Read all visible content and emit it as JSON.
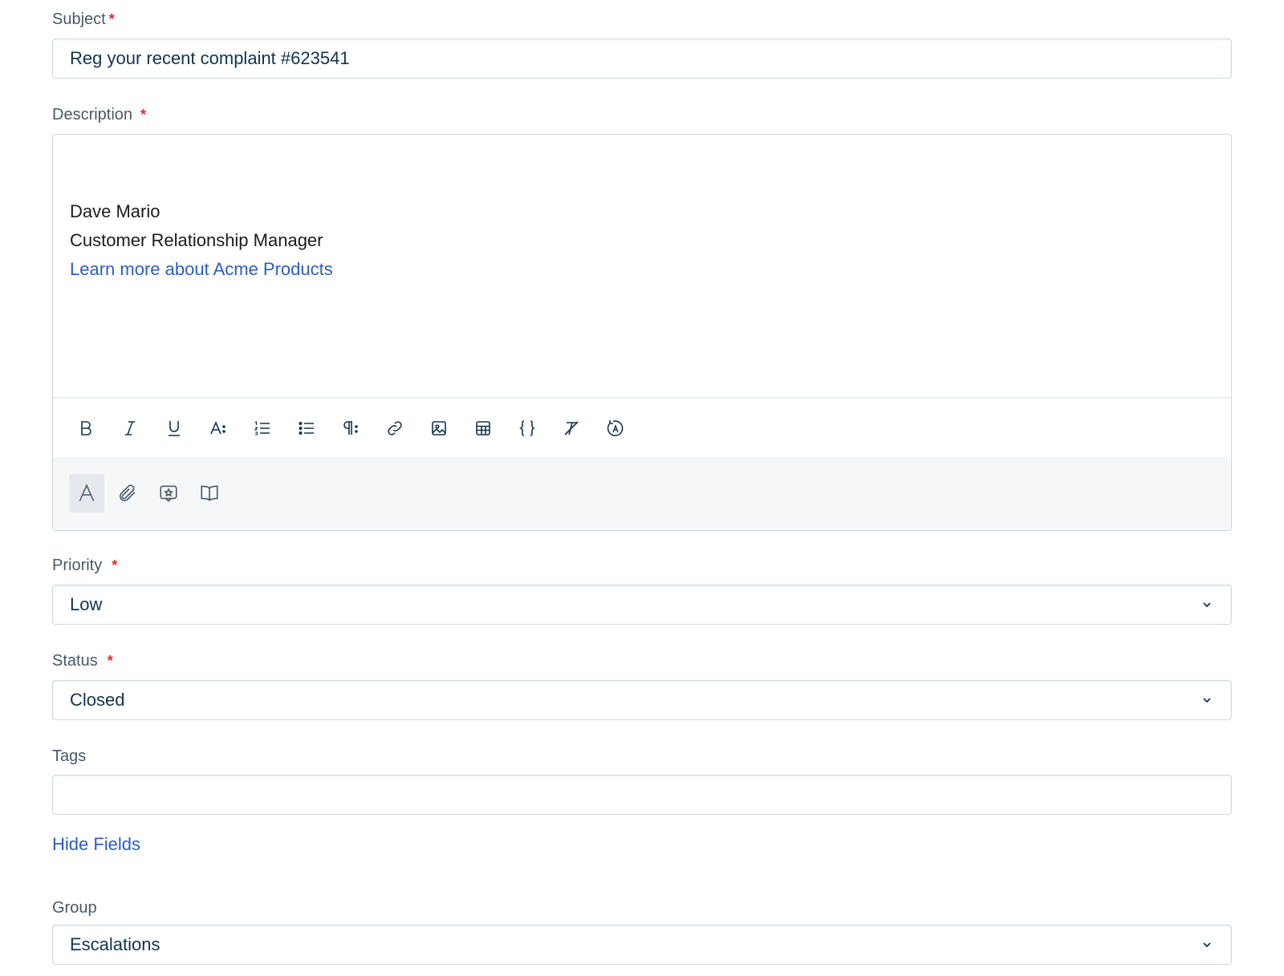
{
  "subject": {
    "label": "Subject",
    "required_mark": "*",
    "value": "Reg your recent complaint #623541"
  },
  "description": {
    "label": "Description",
    "required_mark": "*",
    "lines": [
      "Dave Mario",
      "Customer Relationship Manager"
    ],
    "link_text": "Learn more about Acme Products",
    "toolbar_icons": [
      "bold-icon",
      "italic-icon",
      "underline-icon",
      "font-size-icon",
      "numbered-list-icon",
      "bulleted-list-icon",
      "paragraph-format-icon",
      "link-icon",
      "image-icon",
      "table-icon",
      "code-icon",
      "clear-format-icon",
      "spell-check-icon"
    ],
    "bottom_icons": [
      "text-format-icon",
      "attachment-icon",
      "canned-response-icon",
      "knowledge-base-icon"
    ]
  },
  "priority": {
    "label": "Priority",
    "required_mark": "*",
    "value": "Low"
  },
  "status": {
    "label": "Status",
    "required_mark": "*",
    "value": "Closed"
  },
  "tags": {
    "label": "Tags",
    "value": ""
  },
  "hide_fields": {
    "label": "Hide Fields"
  },
  "group": {
    "label": "Group",
    "value": "Escalations"
  },
  "colors": {
    "link": "#2c5cc5",
    "required": "#d72d30",
    "border": "#cfd7df",
    "label": "#475867"
  }
}
